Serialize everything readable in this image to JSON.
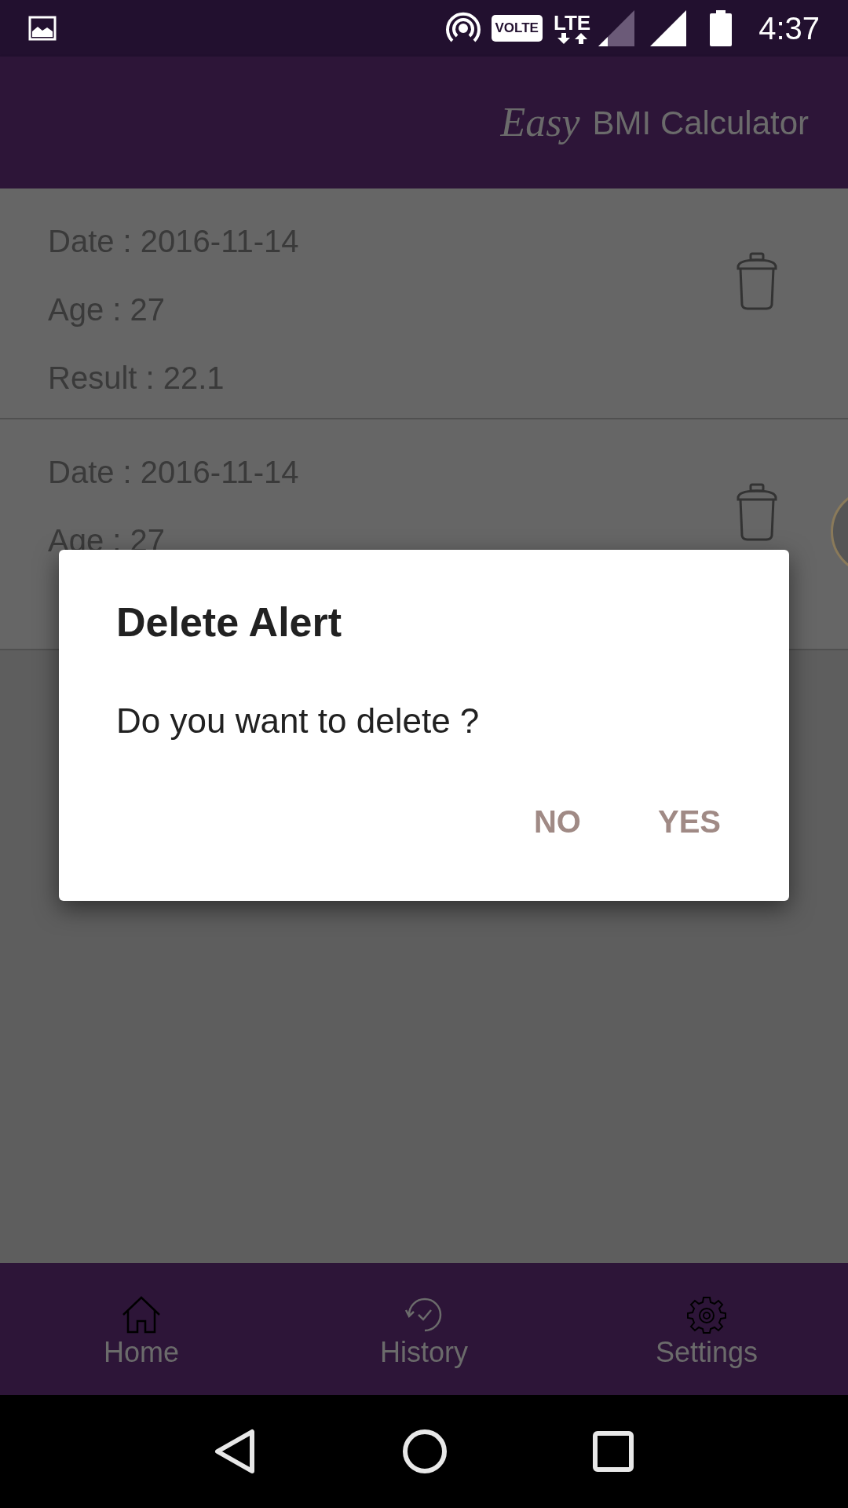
{
  "status_bar": {
    "volte": "VOLTE",
    "network": "LTE",
    "time": "4:37"
  },
  "app_bar": {
    "title_script": "Easy",
    "title": "BMI Calculator"
  },
  "records": [
    {
      "date": "Date : 2016-11-14",
      "age": "Age : 27",
      "result": "Result : 22.1"
    },
    {
      "date": "Date : 2016-11-14",
      "age": "Age : 27"
    }
  ],
  "dialog": {
    "title": "Delete Alert",
    "message": "Do you want to delete ?",
    "buttons": [
      "NO",
      "YES"
    ]
  },
  "bottom_nav": [
    {
      "kind": "home",
      "label": "Home"
    },
    {
      "kind": "history",
      "label": "History"
    },
    {
      "kind": "settings",
      "label": "Settings"
    }
  ]
}
